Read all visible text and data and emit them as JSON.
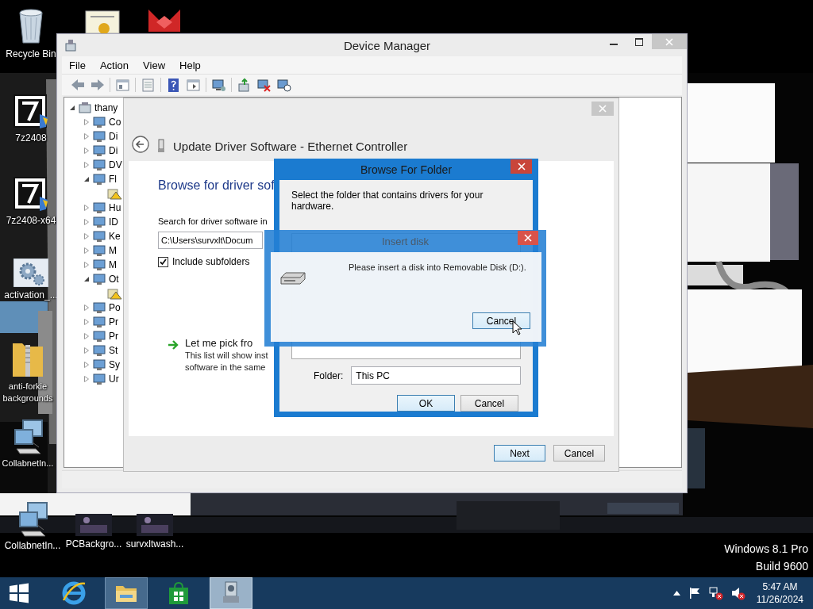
{
  "desktop_icons": [
    {
      "kind": "recycle",
      "label": "Recycle Bin"
    },
    {
      "kind": "certificate"
    },
    {
      "kind": "red-app"
    },
    {
      "kind": "installer",
      "label": "7z2408"
    },
    {
      "kind": "installer",
      "label": "7z2408-x64"
    },
    {
      "kind": "gear",
      "label": "activation_..."
    },
    {
      "kind": "zip",
      "label": "anti-forkie backgrounds"
    },
    {
      "kind": "computer",
      "label": "CollabnetIn..."
    }
  ],
  "bottom_icons": [
    {
      "kind": "computer",
      "label": "CollabnetIn..."
    },
    {
      "kind": "thumb",
      "label": "PCBackgro..."
    },
    {
      "kind": "thumb",
      "label": "survxltwash..."
    }
  ],
  "device_manager": {
    "title": "Device Manager",
    "menu": [
      "File",
      "Action",
      "View",
      "Help"
    ],
    "tree": {
      "label": "thany",
      "expanded": true,
      "children": [
        {
          "label": "Co",
          "expanded": false
        },
        {
          "label": "Di",
          "expanded": false
        },
        {
          "label": "Di",
          "expanded": false
        },
        {
          "label": "DV",
          "expanded": false
        },
        {
          "label": "Fl",
          "expanded": true,
          "children": [
            {
              "warning": true
            }
          ]
        },
        {
          "label": "Hu",
          "expanded": false
        },
        {
          "label": "ID",
          "expanded": false
        },
        {
          "label": "Ke",
          "expanded": false
        },
        {
          "label": "M",
          "expanded": false
        },
        {
          "label": "M",
          "expanded": false
        },
        {
          "label": "Ot",
          "expanded": true,
          "children": [
            {
              "warning": true
            }
          ]
        },
        {
          "label": "Po",
          "expanded": false
        },
        {
          "label": "Pr",
          "expanded": false
        },
        {
          "label": "Pr",
          "expanded": false
        },
        {
          "label": "St",
          "expanded": false
        },
        {
          "label": "Sy",
          "expanded": false
        },
        {
          "label": "Ur",
          "expanded": false
        }
      ]
    }
  },
  "wizard": {
    "title": "Update Driver Software - Ethernet Controller",
    "heading": "Browse for driver sof",
    "search_label": "Search for driver software in",
    "path": "C:\\Users\\survxlt\\Docum",
    "include_subfolders": {
      "label": "Include subfolders",
      "checked": true
    },
    "pick_title": "Let me pick fro",
    "pick_lines": [
      "This list will show inst",
      "software in the same"
    ],
    "buttons": [
      "Next",
      "Cancel"
    ]
  },
  "browse_dialog": {
    "title": "Browse For Folder",
    "prompt": "Select the folder that contains drivers for your hardware.",
    "folder_label": "Folder:",
    "folder_value": "This PC",
    "buttons": [
      "OK",
      "Cancel"
    ]
  },
  "insert_disk": {
    "title": "Insert disk",
    "message": "Please insert a disk into Removable Disk (D:).",
    "button": "Cancel"
  },
  "os_watermark": [
    "Windows 8.1 Pro",
    "Build 9600"
  ],
  "taskbar": {
    "apps": [
      {
        "kind": "ie",
        "running": false,
        "selected": false
      },
      {
        "kind": "explorer",
        "running": true,
        "selected": false
      },
      {
        "kind": "store",
        "running": false,
        "selected": false
      },
      {
        "kind": "device-manager",
        "running": true,
        "selected": true
      }
    ],
    "time": "5:47 AM",
    "date": "11/26/2024"
  }
}
